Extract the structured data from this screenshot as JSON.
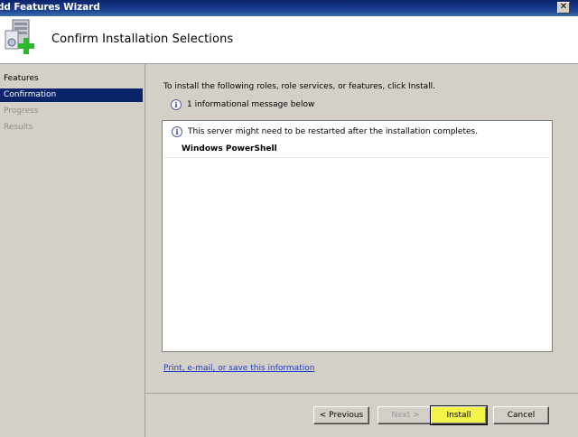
{
  "window": {
    "title": "dd Features Wizard",
    "close_glyph": "✕"
  },
  "header": {
    "title": "Confirm Installation Selections",
    "icon": "server-add-icon"
  },
  "sidebar": {
    "items": [
      {
        "label": "Features",
        "state": "normal"
      },
      {
        "label": "Confirmation",
        "state": "active"
      },
      {
        "label": "Progress",
        "state": "disabled"
      },
      {
        "label": "Results",
        "state": "disabled"
      }
    ]
  },
  "main": {
    "intro": "To install the following roles, role services, or features, click Install.",
    "info_count": "1 informational message below",
    "info_glyph": "i",
    "listbox": {
      "message": "This server might need to be restarted after the installation completes.",
      "feature": "Windows PowerShell"
    },
    "link": "Print, e-mail, or save this information"
  },
  "buttons": {
    "previous": "< Previous",
    "next": "Next >",
    "install": "Install",
    "cancel": "Cancel"
  },
  "colors": {
    "title_bar": "#0a246a",
    "selection": "#0a246a",
    "install_highlight": "#f3f34a",
    "link": "#1a3cc8"
  }
}
